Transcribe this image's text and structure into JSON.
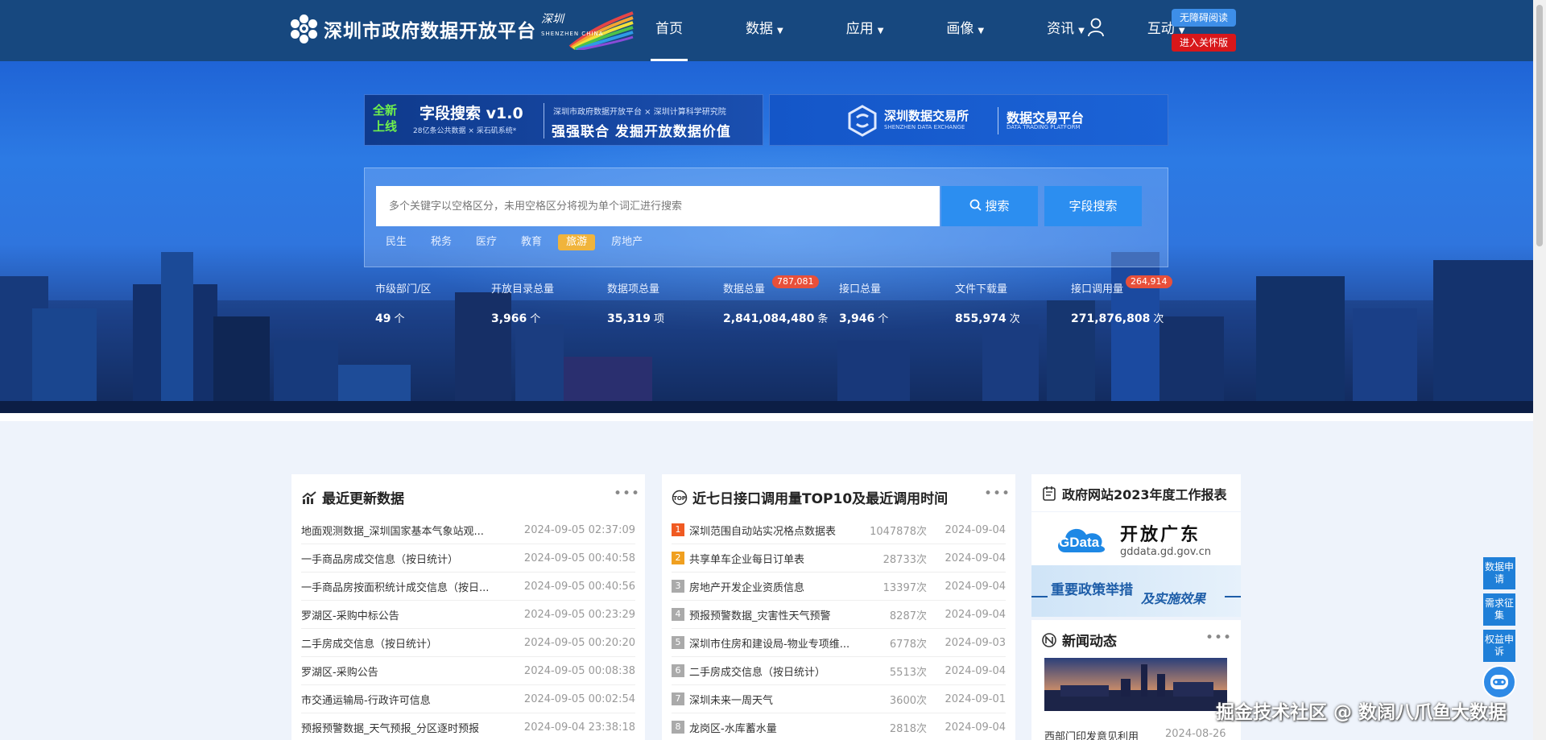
{
  "header": {
    "site_title": "深圳市政府数据开放平台",
    "sz_logo_text": "SHENZHEN CHINA",
    "nav": [
      {
        "label": "首页",
        "dropdown": false,
        "active": true
      },
      {
        "label": "数据",
        "dropdown": true
      },
      {
        "label": "应用",
        "dropdown": true
      },
      {
        "label": "画像",
        "dropdown": true
      },
      {
        "label": "资讯",
        "dropdown": true
      },
      {
        "label": "互动",
        "dropdown": true
      }
    ],
    "accessibility_label": "无障碍阅读",
    "care_label": "进入关怀版",
    "bg_color": "#17487f"
  },
  "banner_left": {
    "badge": "全新上线",
    "title": "字段搜索 v1.0",
    "subtitle": "28亿条公共数据 × 采石矶系统*",
    "org": "深圳市政府数据开放平台 × 深圳计算科学研究院",
    "slogan": "强强联合 发掘开放数据价值"
  },
  "banner_right": {
    "exchange_name": "深圳数据交易所",
    "exchange_en": "SHENZHEN DATA EXCHANGE",
    "platform": "数据交易平台",
    "platform_en": "DATA TRADING PLATFORM"
  },
  "search": {
    "placeholder": "多个关键字以空格区分，未用空格区分将视为单个词汇进行搜索",
    "search_label": "搜索",
    "field_search_label": "字段搜索",
    "tags": [
      {
        "label": "民生",
        "highlighted": false
      },
      {
        "label": "税务",
        "highlighted": false
      },
      {
        "label": "医疗",
        "highlighted": false
      },
      {
        "label": "教育",
        "highlighted": false
      },
      {
        "label": "旅游",
        "highlighted": true
      },
      {
        "label": "房地产",
        "highlighted": false
      }
    ]
  },
  "stats": [
    {
      "label": "市级部门/区",
      "value": "49",
      "unit": "个",
      "badge": ""
    },
    {
      "label": "开放目录总量",
      "value": "3,966",
      "unit": "个",
      "badge": ""
    },
    {
      "label": "数据项总量",
      "value": "35,319",
      "unit": "项",
      "badge": ""
    },
    {
      "label": "数据总量",
      "value": "2,841,084,480",
      "unit": "条",
      "badge": "787,081"
    },
    {
      "label": "接口总量",
      "value": "3,946",
      "unit": "个",
      "badge": ""
    },
    {
      "label": "文件下载量",
      "value": "855,974",
      "unit": "次",
      "badge": ""
    },
    {
      "label": "接口调用量",
      "value": "271,876,808",
      "unit": "次",
      "badge": "264,914"
    }
  ],
  "recent": {
    "title": "最近更新数据",
    "more": "•••",
    "rows": [
      {
        "name": "地面观测数据_深圳国家基本气象站观...",
        "time": "2024-09-05 02:37:09"
      },
      {
        "name": "一手商品房成交信息（按日统计）",
        "time": "2024-09-05 00:40:58"
      },
      {
        "name": "一手商品房按面积统计成交信息（按日...",
        "time": "2024-09-05 00:40:56"
      },
      {
        "name": "罗湖区-采购中标公告",
        "time": "2024-09-05 00:23:29"
      },
      {
        "name": "二手房成交信息（按日统计）",
        "time": "2024-09-05 00:20:20"
      },
      {
        "name": "罗湖区-采购公告",
        "time": "2024-09-05 00:08:38"
      },
      {
        "name": "市交通运输局-行政许可信息",
        "time": "2024-09-05 00:02:54"
      },
      {
        "name": "预报预警数据_天气预报_分区逐时预报",
        "time": "2024-09-04 23:38:18"
      }
    ]
  },
  "top10": {
    "title": "近七日接口调用量TOP10及最近调用时间",
    "more": "•••",
    "rows": [
      {
        "rank": "1",
        "name": "深圳范围自动站实况格点数据表",
        "calls": "1047878次",
        "date": "2024-09-04",
        "color": "#f05a22"
      },
      {
        "rank": "2",
        "name": "共享单车企业每日订单表",
        "calls": "28733次",
        "date": "2024-09-04",
        "color": "#f0a020"
      },
      {
        "rank": "3",
        "name": "房地产开发企业资质信息",
        "calls": "13397次",
        "date": "2024-09-04",
        "color": "#aaaaaa"
      },
      {
        "rank": "4",
        "name": "预报预警数据_灾害性天气预警",
        "calls": "8287次",
        "date": "2024-09-04",
        "color": "#aaaaaa"
      },
      {
        "rank": "5",
        "name": "深圳市住房和建设局-物业专项维...",
        "calls": "6778次",
        "date": "2024-09-03",
        "color": "#aaaaaa"
      },
      {
        "rank": "6",
        "name": "二手房成交信息（按日统计）",
        "calls": "5513次",
        "date": "2024-09-04",
        "color": "#aaaaaa"
      },
      {
        "rank": "7",
        "name": "深圳未来一周天气",
        "calls": "3600次",
        "date": "2024-09-01",
        "color": "#aaaaaa"
      },
      {
        "rank": "8",
        "name": "龙岗区-水库蓄水量",
        "calls": "2818次",
        "date": "2024-09-04",
        "color": "#aaaaaa"
      }
    ]
  },
  "side": {
    "report_title": "政府网站2023年度工作报表",
    "gdata_name": "开放广东",
    "gdata_logo": "GData",
    "gdata_url": "gddata.gd.gov.cn",
    "policy_text_a": "重要政策举措",
    "policy_text_b": "及实施效果",
    "news_title": "新闻动态",
    "news_more": "•••",
    "news_item": "西部门印发意见利用",
    "news_date": "2024-08-26"
  },
  "float": {
    "data_request": "数据申请",
    "demand": "需求征集",
    "rights": "权益申诉"
  },
  "watermark": "掘金技术社区 @ 数阔八爪鱼大数据"
}
